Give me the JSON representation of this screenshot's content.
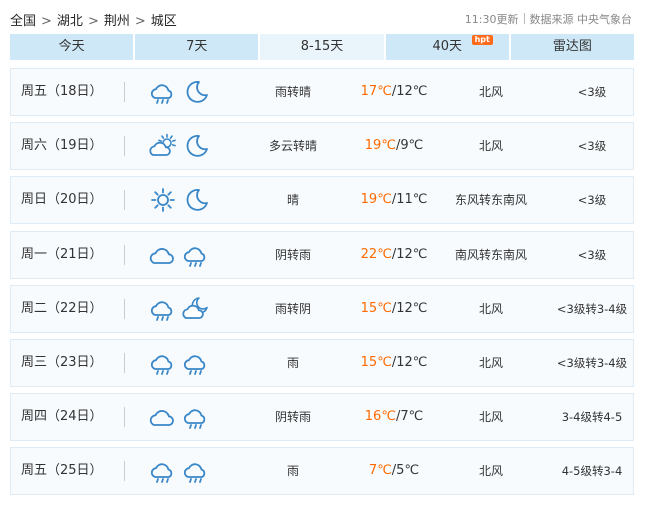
{
  "breadcrumb": [
    {
      "label": "全国"
    },
    {
      "label": "湖北"
    },
    {
      "label": "荆州"
    },
    {
      "label": "城区"
    }
  ],
  "breadcrumb_separator": ">",
  "update": {
    "time": "11:30更新",
    "source": "数据来源 中央气象台"
  },
  "tabs": [
    {
      "label": "今天"
    },
    {
      "label": "7天"
    },
    {
      "label": "8-15天",
      "active": true
    },
    {
      "label": "40天",
      "badge": "hpt"
    },
    {
      "label": "雷达图"
    }
  ],
  "forecast": [
    {
      "day": "周五（18日）",
      "icon1": "rain-cloud-icon",
      "icon2": "moon-icon",
      "desc": "雨转晴",
      "high": "17℃",
      "low": "/12℃",
      "wind": "北风",
      "level": "<3级"
    },
    {
      "day": "周六（19日）",
      "icon1": "partly-cloudy-icon",
      "icon2": "moon-icon",
      "desc": "多云转晴",
      "high": "19℃",
      "low": "/9℃",
      "wind": "北风",
      "level": "<3级"
    },
    {
      "day": "周日（20日）",
      "icon1": "sun-icon",
      "icon2": "moon-icon",
      "desc": "晴",
      "high": "19℃",
      "low": "/11℃",
      "wind": "东风转东南风",
      "level": "<3级"
    },
    {
      "day": "周一（21日）",
      "icon1": "cloud-icon",
      "icon2": "rain-cloud-icon",
      "desc": "阴转雨",
      "high": "22℃",
      "low": "/12℃",
      "wind": "南风转东南风",
      "level": "<3级"
    },
    {
      "day": "周二（22日）",
      "icon1": "rain-cloud-icon",
      "icon2": "moon-cloud-icon",
      "desc": "雨转阴",
      "high": "15℃",
      "low": "/12℃",
      "wind": "北风",
      "level": "<3级转3-4级"
    },
    {
      "day": "周三（23日）",
      "icon1": "rain-cloud-icon",
      "icon2": "rain-cloud-icon",
      "desc": "雨",
      "high": "15℃",
      "low": "/12℃",
      "wind": "北风",
      "level": "<3级转3-4级"
    },
    {
      "day": "周四（24日）",
      "icon1": "cloud-icon",
      "icon2": "rain-cloud-icon",
      "desc": "阴转雨",
      "high": "16℃",
      "low": "/7℃",
      "wind": "北风",
      "level": "3-4级转4-5"
    },
    {
      "day": "周五（25日）",
      "icon1": "rain-cloud-icon",
      "icon2": "rain-cloud-icon",
      "desc": "雨",
      "high": "7℃",
      "low": "/5℃",
      "wind": "北风",
      "level": "4-5级转3-4"
    }
  ],
  "colors": {
    "high_temp": "#ff6a00",
    "icon_stroke": "#3a87c8",
    "tab_bg": "#cfe8f7",
    "tab_active_bg": "#e9f4fb"
  }
}
